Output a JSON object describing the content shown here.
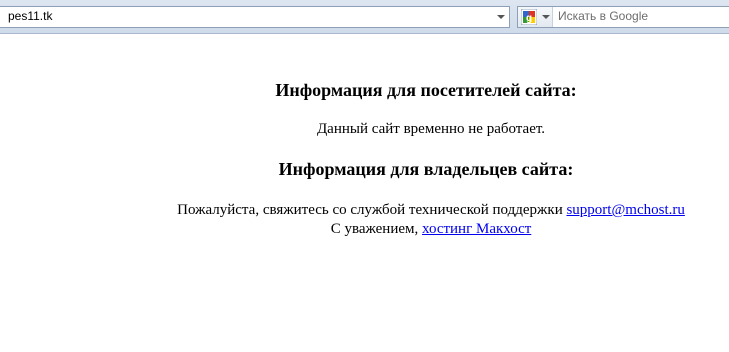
{
  "browser": {
    "address": "pes11.tk",
    "search_placeholder": "Искать в Google",
    "search_engine_icon": "google-icon"
  },
  "page": {
    "visitors_heading": "Информация для посетителей сайта:",
    "site_down_text": "Данный сайт временно не работает.",
    "owners_heading": "Информация для владельцев сайта:",
    "contact_text": "Пожалуйста, свяжитесь со службой технической поддержки",
    "support_email": "support@mchost.ru",
    "regards_text": "С уважением,",
    "hosting_link": "хостинг Макхост"
  },
  "colors": {
    "link": "#0000ee",
    "toolbar": "#dde6f1"
  }
}
